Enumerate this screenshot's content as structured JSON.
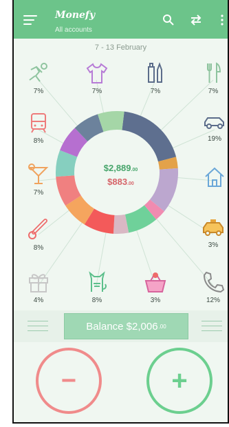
{
  "header": {
    "app_name": "Monefy",
    "account": "All accounts",
    "icons": [
      "menu-icon",
      "search-icon",
      "transfer-icon",
      "more-icon"
    ]
  },
  "period": "7 - 13 February",
  "categories": [
    {
      "name": "sports",
      "icon": "sports-icon",
      "percent": "7%"
    },
    {
      "name": "clothes",
      "icon": "clothes-icon",
      "percent": "7%"
    },
    {
      "name": "toiletry",
      "icon": "toiletry-icon",
      "percent": "7%"
    },
    {
      "name": "food",
      "icon": "food-icon",
      "percent": "7%"
    },
    {
      "name": "transport",
      "icon": "train-icon",
      "percent": "8%"
    },
    {
      "name": "car",
      "icon": "car-icon",
      "percent": "19%"
    },
    {
      "name": "entertainment",
      "icon": "cocktail-icon",
      "percent": "7%"
    },
    {
      "name": "house",
      "icon": "house-icon",
      "percent": ""
    },
    {
      "name": "health",
      "icon": "thermometer-icon",
      "percent": "8%"
    },
    {
      "name": "taxi",
      "icon": "taxi-icon",
      "percent": "3%"
    },
    {
      "name": "gifts",
      "icon": "gift-icon",
      "percent": "4%"
    },
    {
      "name": "pets",
      "icon": "cat-icon",
      "percent": "8%"
    },
    {
      "name": "eating-out",
      "icon": "basket-icon",
      "percent": "3%"
    },
    {
      "name": "communications",
      "icon": "phone-icon",
      "percent": "12%"
    }
  ],
  "summary": {
    "income_main": "$2,889",
    "income_cents": ".00",
    "expense_main": "$883",
    "expense_cents": ".00"
  },
  "balance": {
    "label_main": "Balance $2,006",
    "label_cents": ".00"
  },
  "actions": {
    "minus_symbol": "−",
    "plus_symbol": "+"
  },
  "colors": {
    "header": "#6cc48a",
    "income": "#47a56b",
    "expense": "#d6656a",
    "minus_button": "#f08b8b",
    "plus_button": "#6ccf8f"
  },
  "chart_data": {
    "type": "pie",
    "segments": [
      {
        "color": "#5e6f8f",
        "value": 19
      },
      {
        "color": "#e3a24a",
        "value": 3
      },
      {
        "color": "#bca7cf",
        "value": 12
      },
      {
        "color": "#f08bb0",
        "value": 3
      },
      {
        "color": "#6fd19a",
        "value": 8
      },
      {
        "color": "#d9b8c4",
        "value": 4
      },
      {
        "color": "#f35a5a",
        "value": 8
      },
      {
        "color": "#f5a55e",
        "value": 7
      },
      {
        "color": "#f08080",
        "value": 8
      },
      {
        "color": "#86cfbf",
        "value": 7
      },
      {
        "color": "#b66fd0",
        "value": 7
      },
      {
        "color": "#6c829c",
        "value": 7
      },
      {
        "color": "#a5d6a7",
        "value": 7
      }
    ]
  }
}
